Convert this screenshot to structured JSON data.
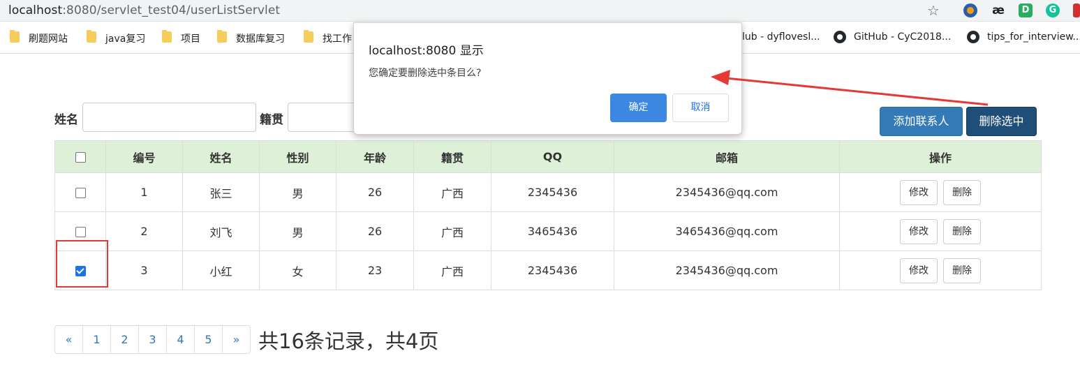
{
  "browser": {
    "url_host": "localhost",
    "url_rest": ":8080/servlet_test04/userListServlet",
    "bookmarks": [
      {
        "label": "刷题网站",
        "type": "folder"
      },
      {
        "label": "java复习",
        "type": "folder"
      },
      {
        "label": "项目",
        "type": "folder"
      },
      {
        "label": "数据库复习",
        "type": "folder"
      },
      {
        "label": "找工作",
        "type": "folder"
      },
      {
        "label": "lub - dyflovesl...",
        "type": "github"
      },
      {
        "label": "GitHub - CyC2018...",
        "type": "github"
      },
      {
        "label": "tips_for_interview...",
        "type": "github"
      }
    ],
    "extensions": [
      {
        "name": "firefox-like-icon",
        "color": "#2a5db0",
        "glyph": ""
      },
      {
        "name": "ae-icon",
        "color": "#ffffff",
        "glyph": "æ"
      },
      {
        "name": "green-d-icon",
        "color": "#27ae60",
        "glyph": "D"
      },
      {
        "name": "grammarly-icon",
        "color": "#15c39a",
        "glyph": "G"
      }
    ]
  },
  "search": {
    "name_label": "姓名",
    "origin_label": "籍贯"
  },
  "actions": {
    "add_label": "添加联系人",
    "delete_selected_label": "删除选中",
    "add_color": "#337ab7",
    "delete_color": "#1f4e79"
  },
  "table": {
    "headers": [
      "编号",
      "姓名",
      "性别",
      "年龄",
      "籍贯",
      "QQ",
      "邮箱",
      "操作"
    ],
    "rows": [
      {
        "checked": false,
        "id": "1",
        "name": "张三",
        "gender": "男",
        "age": "26",
        "origin": "广西",
        "qq": "2345436",
        "email": "2345436@qq.com"
      },
      {
        "checked": false,
        "id": "2",
        "name": "刘飞",
        "gender": "男",
        "age": "26",
        "origin": "广西",
        "qq": "3465436",
        "email": "3465436@qq.com"
      },
      {
        "checked": true,
        "id": "3",
        "name": "小红",
        "gender": "女",
        "age": "23",
        "origin": "广西",
        "qq": "2345436",
        "email": "2345436@qq.com"
      }
    ],
    "edit_label": "修改",
    "delete_label": "删除"
  },
  "pagination": {
    "items": [
      "«",
      "1",
      "2",
      "3",
      "4",
      "5",
      "»"
    ],
    "summary": "共16条记录，共4页"
  },
  "dialog": {
    "title": "localhost:8080 显示",
    "message": "您确定要删除选中条目么?",
    "ok_label": "确定",
    "cancel_label": "取消",
    "ok_color": "#3c87e0"
  },
  "annotation": {
    "highlight_color": "#e53935"
  }
}
